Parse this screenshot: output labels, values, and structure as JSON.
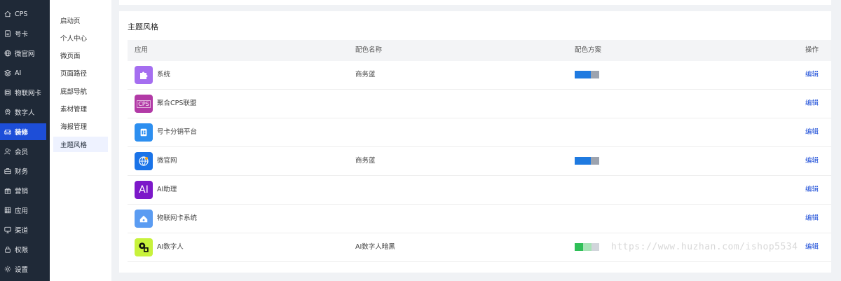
{
  "sidebar": {
    "items": [
      {
        "label": "CPS",
        "icon": "home-icon"
      },
      {
        "label": "号卡",
        "icon": "sim-card-icon"
      },
      {
        "label": "微官网",
        "icon": "globe-icon"
      },
      {
        "label": "AI",
        "icon": "layers-icon"
      },
      {
        "label": "物联网卡",
        "icon": "card-icon"
      },
      {
        "label": "数字人",
        "icon": "person-badge-icon"
      },
      {
        "label": "装修",
        "icon": "sofa-icon"
      },
      {
        "label": "会员",
        "icon": "user-icon"
      },
      {
        "label": "财务",
        "icon": "briefcase-icon"
      },
      {
        "label": "营销",
        "icon": "gift-icon"
      },
      {
        "label": "应用",
        "icon": "grid-icon"
      },
      {
        "label": "渠道",
        "icon": "monitor-icon"
      },
      {
        "label": "权限",
        "icon": "lock-icon"
      },
      {
        "label": "设置",
        "icon": "gear-icon"
      }
    ],
    "active_color": "#1d4ed8"
  },
  "subnav": {
    "items": [
      "启动页",
      "个人中心",
      "微页面",
      "页面路径",
      "底部导航",
      "素材管理",
      "海报管理",
      "主题风格"
    ]
  },
  "main": {
    "title": "主题风格",
    "columns": {
      "app": "应用",
      "name": "配色名称",
      "scheme": "配色方案",
      "action": "操作"
    },
    "rows": [
      {
        "app": "系统",
        "scheme_name": "商务蓝",
        "icon": "puzzle-icon",
        "icon_color": "#a56ef0",
        "swatch": [
          "#1f7ae0",
          "#9ca3af"
        ],
        "action": "编辑"
      },
      {
        "app": "聚合CPS联盟",
        "scheme_name": "",
        "icon": "cps-icon",
        "icon_text": "CPS",
        "icon_color": "#b23aa6",
        "swatch": [],
        "action": "编辑"
      },
      {
        "app": "号卡分销平台",
        "scheme_name": "",
        "icon": "sim-icon",
        "icon_color": "#2d8ff0",
        "swatch": [],
        "action": "编辑"
      },
      {
        "app": "微官网",
        "scheme_name": "商务蓝",
        "icon": "globe-app-icon",
        "icon_color": "#1a73e8",
        "swatch": [
          "#1f7ae0",
          "#9ca3af"
        ],
        "action": "编辑"
      },
      {
        "app": "AI助理",
        "scheme_name": "",
        "icon": "ai-icon",
        "icon_text": "AI",
        "icon_color": "#7c18c9",
        "swatch": [],
        "action": "编辑"
      },
      {
        "app": "物联网卡系统",
        "scheme_name": "",
        "icon": "iot-icon",
        "icon_color": "#5b9cf2",
        "swatch": [],
        "action": "编辑"
      },
      {
        "app": "AI数字人",
        "scheme_name": "AI数字人暗黑",
        "icon": "digital-human-icon",
        "icon_color": "#c8f23c",
        "swatch": [
          "#2fbf57",
          "#a7e3b6",
          "#d1d5db"
        ],
        "action": "编辑"
      }
    ]
  },
  "watermark": "https://www.huzhan.com/ishop5534"
}
